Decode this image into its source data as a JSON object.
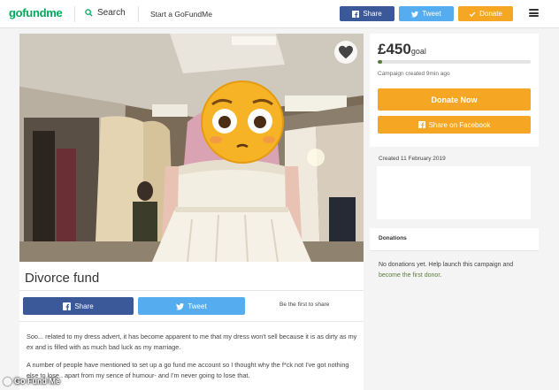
{
  "header": {
    "logo": "gofundme",
    "search_label": "Search",
    "start_label": "Start a GoFundMe",
    "share_label": "Share",
    "tweet_label": "Tweet",
    "donate_label": "Donate"
  },
  "campaign": {
    "title": "Divorce fund",
    "share_label": "Share",
    "tweet_label": "Tweet",
    "first_share": "Be the first to share",
    "story": [
      "Soo... related to my dress advert, it has become apparent to me that my dress won't sell because it is as dirty as my ex and is filled with as much bad luck as my marriage.",
      "A number of people have mentioned to set up a go fund me account so I thought why the f*ck not I've got nothing else to lose.. apart from my sence of humour- and I'm never going to lose that."
    ]
  },
  "sidebar": {
    "goal_amount": "£450",
    "goal_label": "goal",
    "progress_fraction": 0.03,
    "created_ago": "Campaign created 9min ago",
    "donate_now": "Donate Now",
    "share_facebook": "Share on Facebook",
    "created_date": "Created 11 February 2019",
    "donations_heading": "Donations",
    "no_donations": "No donations yet. Help launch this campaign and",
    "first_donor_link": "become the first donor",
    "first_donor_end": "."
  },
  "watermark": "Go Fund Me",
  "colors": {
    "brand_green": "#02a95c",
    "facebook_blue": "#3b5998",
    "twitter_blue": "#55acee",
    "donate_orange": "#f5a623",
    "progress_green": "#5a7b3a"
  }
}
